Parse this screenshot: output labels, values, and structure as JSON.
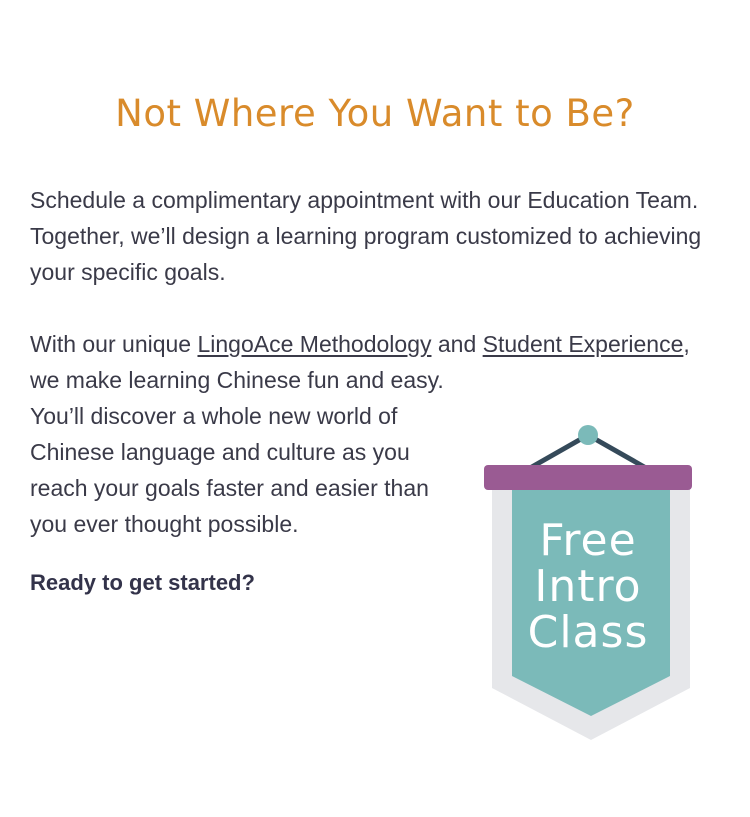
{
  "heading": "Not Where You Want to Be?",
  "intro": "Schedule a complimentary appointment with our Education Team. Together, we’ll design a learning program customized to achieving your specific goals.",
  "body": {
    "prefix": "With our unique ",
    "link1": "LingoAce Methodology",
    "middle": " and ",
    "link2": "Student Experience",
    "suffix": ",",
    "line2": "we make learning Chinese fun and easy.",
    "line3": "You’ll discover a whole new world of",
    "line4": "Chinese language and culture as you",
    "line5": "reach your goals faster and easier than",
    "line6": "you ever thought possible."
  },
  "cta": "Ready to get started?",
  "banner": {
    "line1": "Free",
    "line2": "Intro",
    "line3": "Class"
  },
  "colors": {
    "heading": "#d98b2b",
    "text": "#3a3a48",
    "banner_teal": "#7bbab9",
    "banner_purple": "#9a5b93",
    "banner_outline": "#e6e7ea",
    "hanger": "#354a5a"
  }
}
